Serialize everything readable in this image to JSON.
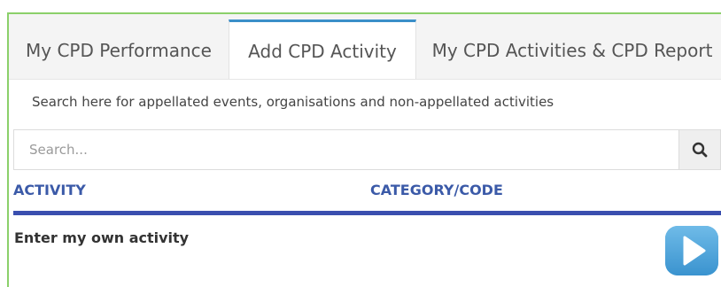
{
  "tabs": [
    {
      "label": "My CPD Performance",
      "active": false
    },
    {
      "label": "Add CPD Activity",
      "active": true
    },
    {
      "label": "My CPD Activities & CPD Report",
      "active": false
    }
  ],
  "search": {
    "hint": "Search here for appellated events, organisations and non-appellated activities",
    "placeholder": "Search...",
    "value": "",
    "button_icon": "search-icon"
  },
  "table": {
    "columns": [
      "ACTIVITY",
      "CATEGORY/CODE"
    ]
  },
  "own_activity": {
    "label": "Enter my own activity",
    "button_icon": "play-icon"
  },
  "colors": {
    "accent_tab": "#3a8fc9",
    "column_header": "#3b5aa8",
    "header_rule": "#3a4faf",
    "play_button": "#4aa3d9",
    "frame_border": "#8bd06a"
  }
}
